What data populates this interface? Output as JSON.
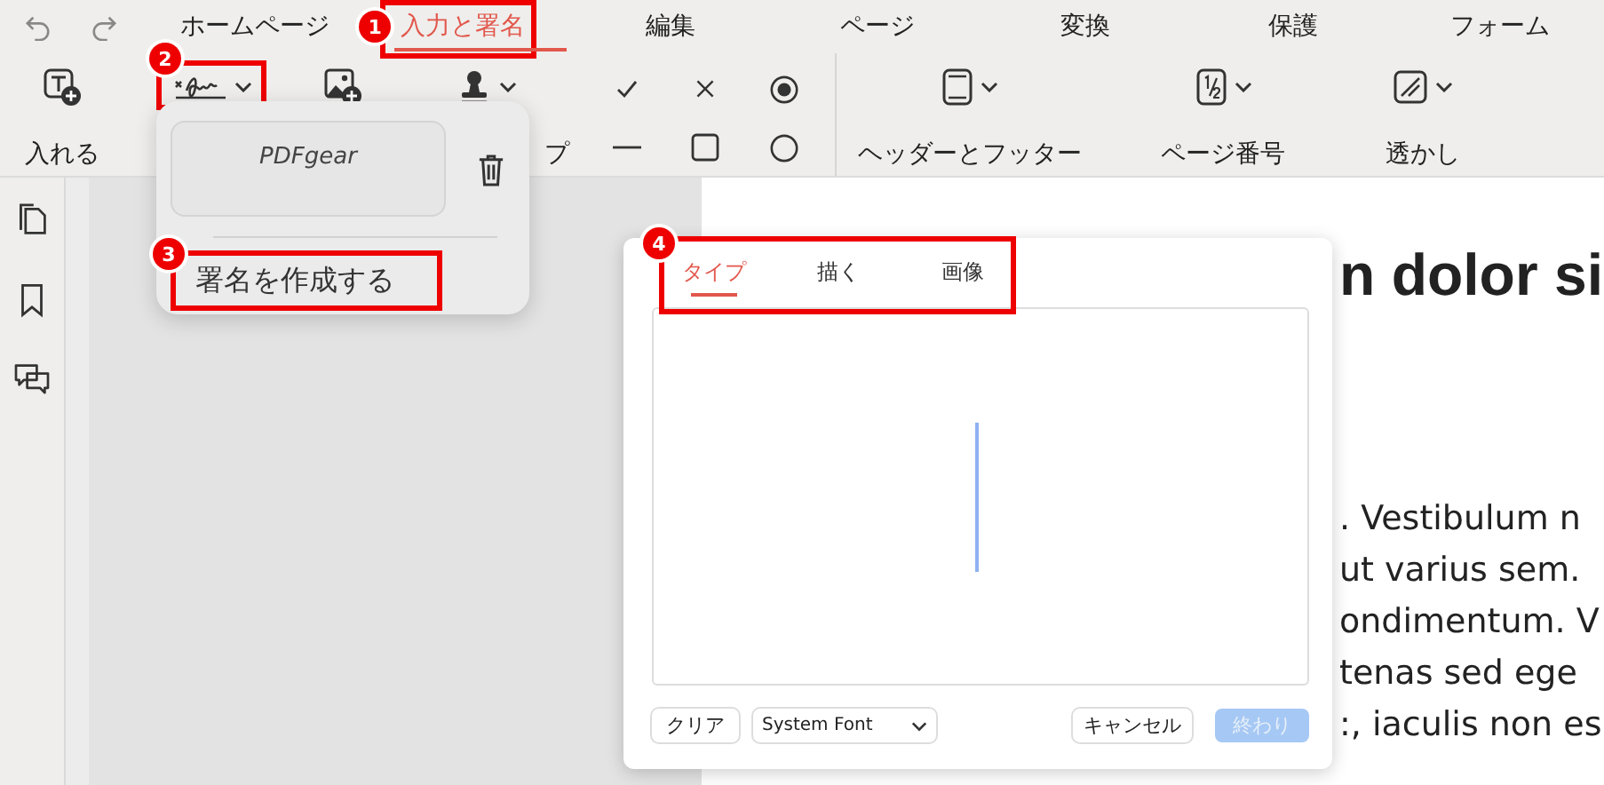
{
  "menu_tabs": [
    {
      "label": "ホームページ",
      "selected": false
    },
    {
      "label": "入力と署名",
      "selected": true,
      "annotation": "1"
    },
    {
      "label": "編集",
      "selected": false
    },
    {
      "label": "ページ",
      "selected": false
    },
    {
      "label": "変換",
      "selected": false
    },
    {
      "label": "保護",
      "selected": false
    },
    {
      "label": "フォーム",
      "selected": false
    }
  ],
  "toolbar": {
    "tools": [
      {
        "kind": "text-add",
        "label": "入れる",
        "dropdown": false
      },
      {
        "kind": "signature",
        "dropdown": true,
        "annotation": "2"
      },
      {
        "kind": "image-add",
        "dropdown": false
      },
      {
        "kind": "stamp",
        "label": "プ",
        "dropdown": true
      }
    ],
    "marks": [
      {
        "kind": "check"
      },
      {
        "kind": "cross"
      },
      {
        "kind": "radio"
      },
      {
        "kind": "dash"
      },
      {
        "kind": "square"
      },
      {
        "kind": "circle"
      }
    ],
    "page_tools": [
      {
        "kind": "header-footer",
        "label": "ヘッダーとフッター",
        "dropdown": true
      },
      {
        "kind": "page-number",
        "label": "ページ番号",
        "dropdown": true
      },
      {
        "kind": "watermark",
        "label": "透かし",
        "dropdown": true
      }
    ]
  },
  "sidebar": {
    "items": [
      {
        "kind": "pages"
      },
      {
        "kind": "bookmark"
      },
      {
        "kind": "comments"
      }
    ]
  },
  "document": {
    "heading": "n dolor si",
    "lines": [
      ". Vestibulum n",
      "ut varius sem.",
      "ondimentum. V",
      "tenas sed ege",
      ":, iaculis non es"
    ]
  },
  "signature_menu": {
    "saved_signature": "PDFgear",
    "create_label": "署名を作成する",
    "annotation": "3"
  },
  "dialog": {
    "annotation": "4",
    "tabs": [
      {
        "label": "タイプ",
        "selected": true
      },
      {
        "label": "描く",
        "selected": false
      },
      {
        "label": "画像",
        "selected": false
      }
    ],
    "clear_button": "クリア",
    "font_select": "System Font",
    "buttons": [
      {
        "label": "キャンセル",
        "disabled": false
      },
      {
        "label": "終わり",
        "disabled": true
      }
    ]
  }
}
